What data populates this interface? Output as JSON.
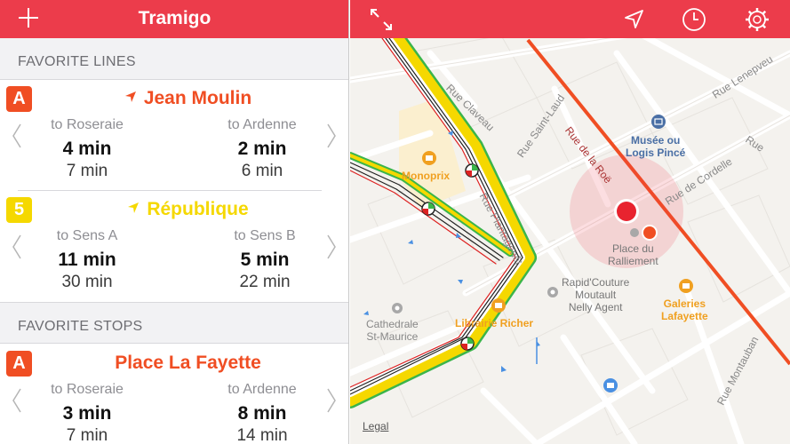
{
  "app": {
    "title": "Tramigo"
  },
  "sections": {
    "lines": "FAVORITE LINES",
    "stops": "FAVORITE STOPS"
  },
  "lines": [
    {
      "badge": "A",
      "badge_color": "#f04e23",
      "title_color": "#f04e23",
      "name": "Jean Moulin",
      "left": {
        "to": "to Roseraie",
        "next": "4 min",
        "after": "7 min"
      },
      "right": {
        "to": "to Ardenne",
        "next": "2 min",
        "after": "6 min"
      }
    },
    {
      "badge": "5",
      "badge_color": "#f5d800",
      "title_color": "#f5d800",
      "name": "République",
      "left": {
        "to": "to Sens A",
        "next": "11 min",
        "after": "30 min"
      },
      "right": {
        "to": "to Sens B",
        "next": "5 min",
        "after": "22 min"
      }
    }
  ],
  "stops": [
    {
      "badge": "A",
      "badge_color": "#f04e23",
      "title_color": "#f04e23",
      "name": "Place La Fayette",
      "left": {
        "to": "to Roseraie",
        "next": "3 min",
        "after": "7 min"
      },
      "right": {
        "to": "to Ardenne",
        "next": "8 min",
        "after": "14 min"
      }
    }
  ],
  "map": {
    "streets": {
      "claveau": "Rue Claveau",
      "saint_laud": "Rue Saint-Laud",
      "rue_de_la_roe": "Rue de la Roë",
      "lenepveu": "Rue Lenepveu",
      "cordelle": "Rue de Cordelle",
      "plantagenet": "Rue Plantagenêt",
      "montauban": "Rue Montauban"
    },
    "pois": {
      "musee": [
        "Musée ou",
        "Logis Pincé"
      ],
      "monoprix": "Monoprix",
      "place": [
        "Place du",
        "Ralliement"
      ],
      "rapid": [
        "Rapid'Couture",
        "Moutault",
        "Nelly Agent"
      ],
      "galeries": [
        "Galeries",
        "Lafayette"
      ],
      "cathedrale": [
        "Cathedrale",
        "St-Maurice"
      ],
      "librairie": "Librairie Richer"
    },
    "legal": "Legal",
    "colors": {
      "header": "#ec3c4b",
      "tram_line_a": "#f04e23",
      "bus_green": "#3bb54a",
      "bus_yellow": "#f5d800",
      "poi_orange": "#f0a020",
      "poi_blue": "#4a6fa5"
    },
    "icons": [
      "expand-icon",
      "location-arrow-icon",
      "clock-icon",
      "settings-gear-icon"
    ]
  }
}
